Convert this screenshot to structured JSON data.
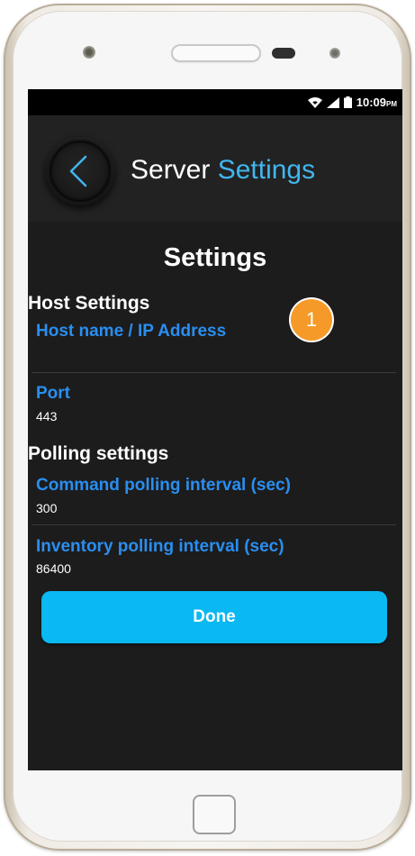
{
  "status_bar": {
    "time": "10:09",
    "time_suffix": "PM",
    "icons": [
      "wifi-icon",
      "signal-icon",
      "battery-icon"
    ]
  },
  "app_bar": {
    "title_part1": "Server",
    "title_part2": "Settings",
    "back_icon": "chevron-left-icon"
  },
  "page_title": "Settings",
  "host_settings": {
    "heading": "Host Settings",
    "host_label": "Host name / IP Address",
    "host_value": "",
    "port_label": "Port",
    "port_value": "443"
  },
  "polling_settings": {
    "heading": "Polling settings",
    "command_label": "Command polling interval (sec)",
    "command_value": "300",
    "inventory_label": "Inventory polling interval (sec)",
    "inventory_value": "86400"
  },
  "done_label": "Done",
  "callout_number": "1",
  "colors": {
    "accent": "#41b6ee",
    "field_label": "#2a8ef0",
    "button": "#0ab8f2",
    "callout": "#f59a28",
    "background": "#1c1c1c"
  }
}
